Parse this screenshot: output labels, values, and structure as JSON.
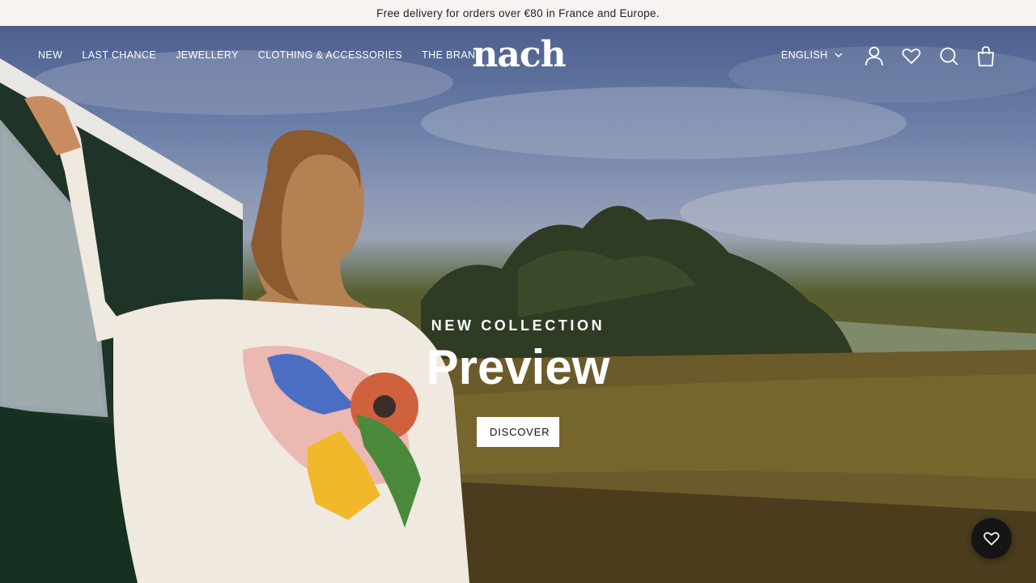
{
  "announcement": "Free delivery for orders over €80 in France and Europe.",
  "nav": {
    "links": [
      "NEW",
      "LAST CHANCE",
      "JEWELLERY",
      "CLOTHING & ACCESSORIES",
      "THE BRAND"
    ],
    "logo": "nach",
    "language": "ENGLISH",
    "icons": [
      "account-icon",
      "wishlist-heart-icon",
      "search-icon",
      "bag-icon"
    ]
  },
  "hero": {
    "eyebrow": "NEW COLLECTION",
    "headline": "Preview",
    "cta_label": "DISCOVER"
  },
  "floating_button": {
    "icon": "heart-icon"
  },
  "colors": {
    "announcement_bg": "#f6f3f0",
    "fab_bg": "#151515",
    "cta_bg": "#ffffff"
  }
}
